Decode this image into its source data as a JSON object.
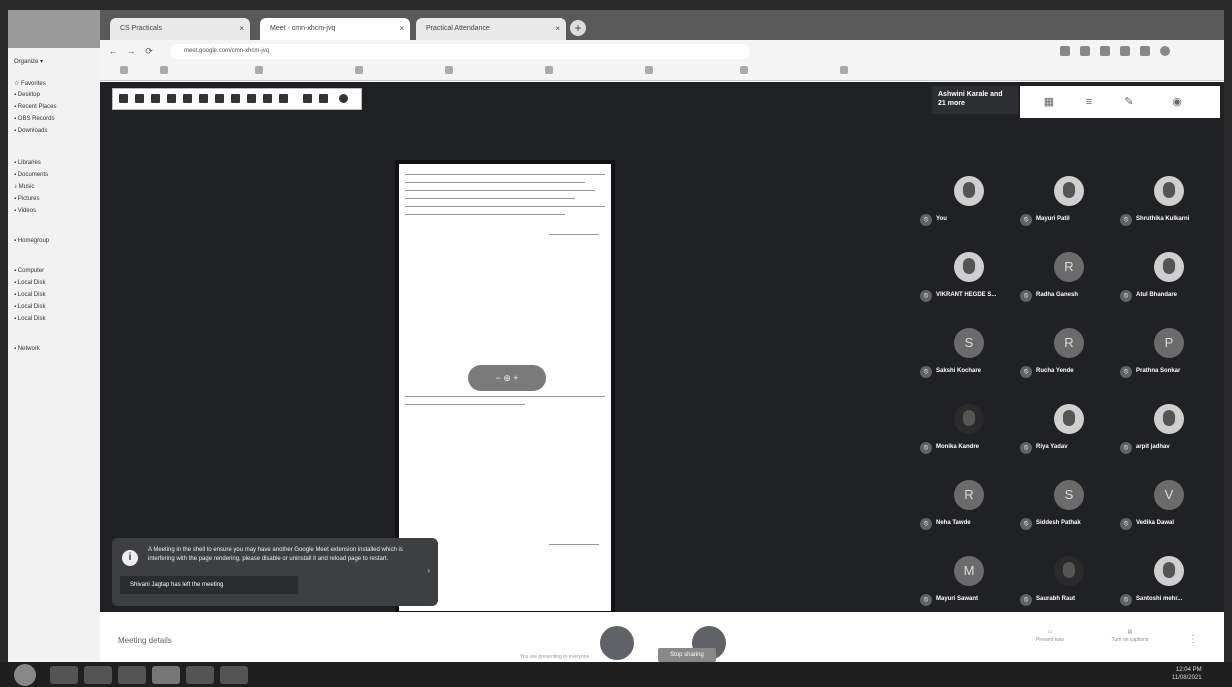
{
  "browser": {
    "tabs": [
      {
        "label": "CS Practicals"
      },
      {
        "label": "Meet - cmn-xhcm-jvq"
      },
      {
        "label": "Practical Attendance"
      }
    ],
    "url": "meet.google.com/cmn-xhcm-jvq"
  },
  "meet": {
    "people_header": "Ashwini Karale and 21 more",
    "participants": [
      {
        "name": "You",
        "avatar": "",
        "photo": true
      },
      {
        "name": "Mayuri Patil",
        "avatar": "",
        "photo": true
      },
      {
        "name": "Shruthika Kulkarni",
        "avatar": "",
        "photo": true
      },
      {
        "name": "VIKRANT HEGDE S...",
        "avatar": "",
        "photo": true
      },
      {
        "name": "Radha Ganesh",
        "avatar": "R",
        "photo": false
      },
      {
        "name": "Atul Bhandare",
        "avatar": "",
        "photo": true
      },
      {
        "name": "Sakshi Kochare",
        "avatar": "S",
        "photo": false
      },
      {
        "name": "Rucha Yende",
        "avatar": "R",
        "photo": false
      },
      {
        "name": "Prathna Sonkar",
        "avatar": "P",
        "photo": false
      },
      {
        "name": "Monika Kandre",
        "avatar": "",
        "photo": true
      },
      {
        "name": "Riya Yadav",
        "avatar": "",
        "photo": true
      },
      {
        "name": "arpit jadhav",
        "avatar": "",
        "photo": true
      },
      {
        "name": "Neha Tawde",
        "avatar": "R",
        "photo": false
      },
      {
        "name": "Siddesh Pathak",
        "avatar": "S",
        "photo": false
      },
      {
        "name": "Vedika Dawal",
        "avatar": "V",
        "photo": false
      },
      {
        "name": "Mayuri Sawant",
        "avatar": "M",
        "photo": false
      },
      {
        "name": "Saurabh Raut",
        "avatar": "",
        "photo": true
      },
      {
        "name": "Santoshi mehr...",
        "avatar": "",
        "photo": true
      }
    ],
    "toast": {
      "message": "A Meeting in the shell to ensure you may have another Google Meet extension installed which is interfering with the page rendering, please disable or uninstall it and reload page to restart.",
      "left_notice": "Shivani Jagtap has left the meeting",
      "icon": "info-icon"
    },
    "controls": {
      "meeting_details": "Meeting details",
      "present": "Present now",
      "captions": "Turn on captions",
      "end": "Stop sharing",
      "status": "You are presenting to everyone"
    }
  },
  "taskbar": {
    "clock_time": "12:04 PM",
    "clock_date": "11/08/2021"
  }
}
